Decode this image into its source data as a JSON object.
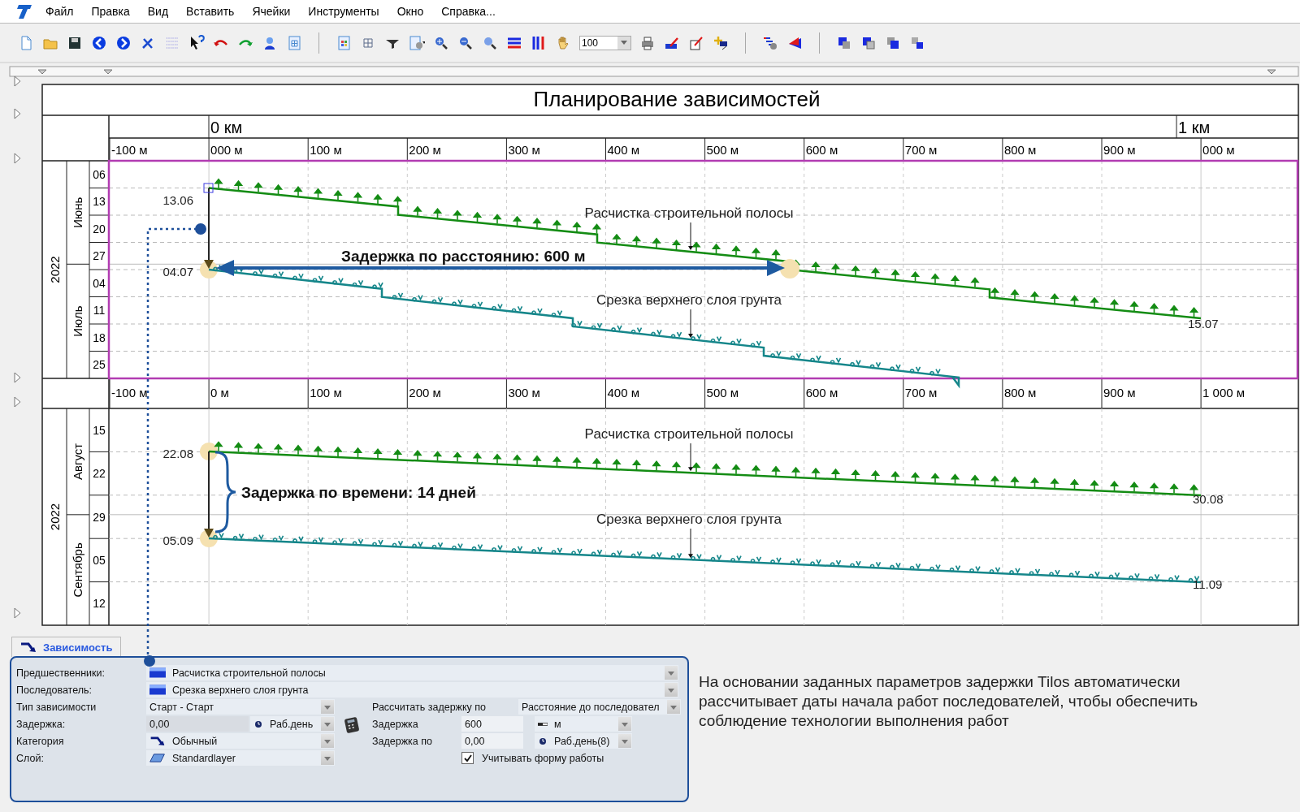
{
  "menu": [
    "Файл",
    "Правка",
    "Вид",
    "Вставить",
    "Ячейки",
    "Инструменты",
    "Окно",
    "Справка..."
  ],
  "toolbar": {
    "zoom_value": "100"
  },
  "plan": {
    "title": "Планирование зависимостей",
    "km_labels": [
      "0 км",
      "1 км"
    ],
    "m_labels": [
      "-100 м",
      "000 м",
      "100 м",
      "200 м",
      "300 м",
      "400 м",
      "500 м",
      "600 м",
      "700 м",
      "800 м",
      "900 м",
      "000 м"
    ],
    "panels": [
      {
        "year": "2022",
        "months": [
          "Июнь",
          "Июль"
        ],
        "days": [
          "06",
          "13",
          "20",
          "27",
          "04",
          "11",
          "18",
          "25"
        ],
        "activities": [
          {
            "label": "Расчистка строительной полосы",
            "kind": "arrow",
            "color": "#148c14",
            "start": "13.06",
            "end": "15.07"
          },
          {
            "label": "Срезка верхнего слоя грунта",
            "kind": "dot",
            "color": "#15868a",
            "start": "04.07"
          }
        ],
        "delay": {
          "kind": "distance",
          "label": "Задержка по расстоянию: 600 м"
        }
      },
      {
        "axis": [
          "-100 м",
          "0 м",
          "100 м",
          "200 м",
          "300 м",
          "400 м",
          "500 м",
          "600 м",
          "700 м",
          "800 м",
          "900 м",
          "1 000 м"
        ],
        "year": "2022",
        "months": [
          "Август",
          "Сентябрь"
        ],
        "days": [
          "15",
          "22",
          "29",
          "05",
          "12"
        ],
        "activities": [
          {
            "label": "Расчистка строительной полосы",
            "kind": "arrow",
            "color": "#148c14",
            "start": "22.08",
            "end": "30.08"
          },
          {
            "label": "Срезка верхнего слоя грунта",
            "kind": "dot",
            "color": "#15868a",
            "start": "05.09",
            "end": "11.09"
          }
        ],
        "delay": {
          "kind": "time",
          "label": "Задержка по времени: 14 дней"
        }
      }
    ]
  },
  "dependency_panel": {
    "tab": "Зависимость",
    "predecessor": {
      "label": "Предшественники:",
      "value": "Расчистка строительной полосы"
    },
    "successor": {
      "label": "Последователь:",
      "value": "Срезка верхнего слоя грунта"
    },
    "dependency_type": {
      "label": "Тип зависимости",
      "value": "Старт - Старт"
    },
    "delay": {
      "label": "Задержка:",
      "value": "0,00",
      "unit": "Раб.день"
    },
    "category": {
      "label": "Категория",
      "value": "Обычный"
    },
    "layer": {
      "label": "Слой:",
      "value": "Standardlayer"
    },
    "calc_by": {
      "label": "Рассчитать задержку по",
      "value": "Расстояние до последовател"
    },
    "distance_delay": {
      "label": "Задержка",
      "value": "600",
      "unit": "м"
    },
    "delay_by": {
      "label": "Задержка по",
      "value": "0,00",
      "unit": "Раб.день(8)"
    },
    "consider_shape": {
      "label": "Учитывать форму работы",
      "checked": true
    }
  },
  "description": "На основании заданных параметров задержки Tilos автоматически рассчитывает даты начала работ последователей, чтобы обеспечить соблюдение технологии выполнения работ"
}
